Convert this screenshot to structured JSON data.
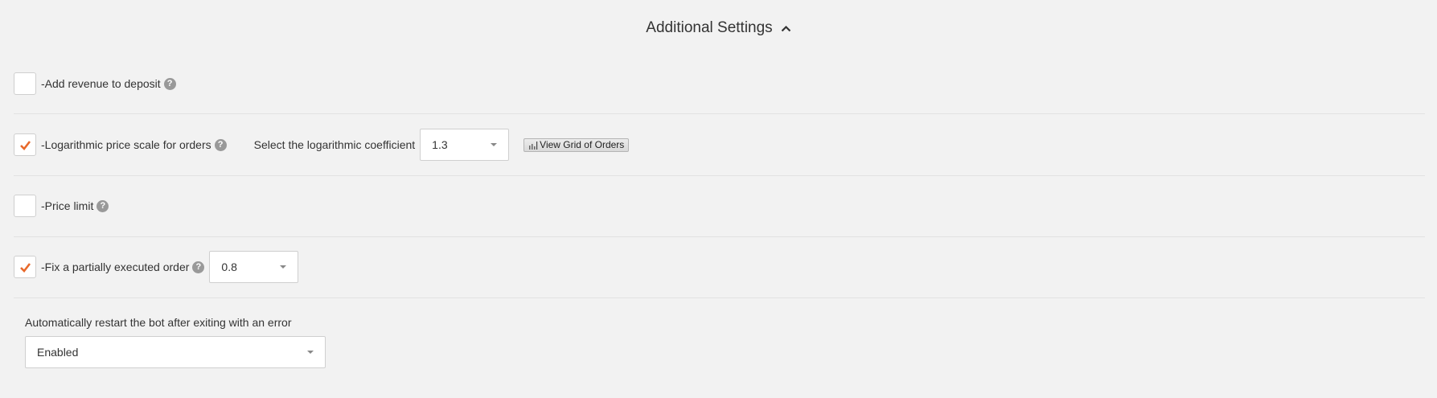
{
  "header": {
    "title": "Additional Settings",
    "chevron_icon": "chevron-up-icon"
  },
  "colors": {
    "checkmark": "#e8692b",
    "background": "#f2f2f2"
  },
  "options": {
    "add_revenue": {
      "label": "-Add revenue to deposit",
      "checked": false,
      "help": "?"
    },
    "log_scale": {
      "label": "-Logarithmic price scale for orders",
      "checked": true,
      "help": "?",
      "coef_label": "Select the logarithmic coefficient",
      "coef_value": "1.3",
      "grid_button_label": "View Grid of Orders"
    },
    "price_limit": {
      "label": "-Price limit",
      "checked": false,
      "help": "?"
    },
    "fix_partial": {
      "label": "-Fix a partially executed order",
      "checked": true,
      "help": "?",
      "value": "0.8"
    }
  },
  "restart": {
    "label": "Automatically restart the bot after exiting with an error",
    "value": "Enabled"
  }
}
